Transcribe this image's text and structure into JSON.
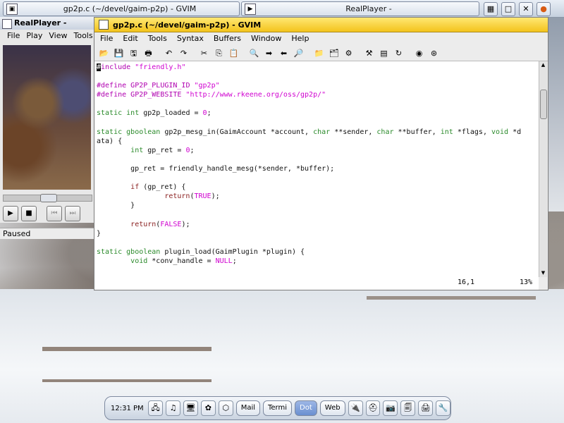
{
  "topbar": {
    "tasks": [
      {
        "label": "gp2p.c (~/devel/gaim-p2p) - GVIM"
      },
      {
        "label": "RealPlayer -"
      }
    ],
    "tray_icons": [
      "window-list-icon",
      "maximize-icon",
      "close-icon",
      "firefox-icon"
    ]
  },
  "realplayer": {
    "title": "RealPlayer -",
    "menu": [
      "File",
      "Play",
      "View",
      "Tools"
    ],
    "status": "Paused"
  },
  "gvim": {
    "title": "gp2p.c (~/devel/gaim-p2p) - GVIM",
    "menu": [
      "File",
      "Edit",
      "Tools",
      "Syntax",
      "Buffers",
      "Window",
      "Help"
    ],
    "code_lines": [
      "#include \"friendly.h\"",
      "",
      "#define GP2P_PLUGIN_ID \"gp2p\"",
      "#define GP2P_WEBSITE \"http://www.rkeene.org/oss/gp2p/\"",
      "",
      "static int gp2p_loaded = 0;",
      "",
      "static gboolean gp2p_mesg_in(GaimAccount *account, char **sender, char **buffer, int *flags, void *d",
      "ata) {",
      "        int gp_ret = 0;",
      "",
      "        gp_ret = friendly_handle_mesg(*sender, *buffer);",
      "",
      "        if (gp_ret) {",
      "                return(TRUE);",
      "        }",
      "",
      "        return(FALSE);",
      "}",
      "",
      "static gboolean plugin_load(GaimPlugin *plugin) {",
      "        void *conv_handle = NULL;"
    ],
    "cursor_pos": "16,1",
    "scroll_pct": "13%"
  },
  "bottom": {
    "clock": "12:31 PM",
    "buttons": [
      "Mail",
      "Termi",
      "Dot",
      "Web"
    ],
    "active_button": "Dot"
  }
}
